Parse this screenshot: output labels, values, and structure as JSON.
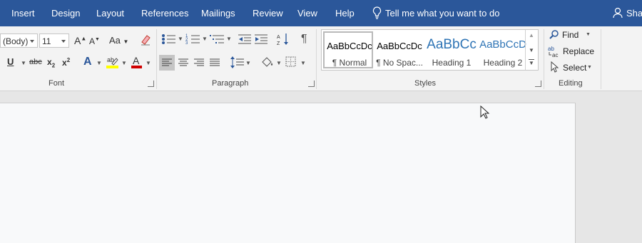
{
  "tabs": {
    "insert": "Insert",
    "design": "Design",
    "layout": "Layout",
    "references": "References",
    "mailings": "Mailings",
    "review": "Review",
    "view": "View",
    "help": "Help"
  },
  "tell_me": "Tell me what you want to do",
  "share": "Shar",
  "font": {
    "name": "(Body)",
    "size": "11",
    "group_label": "Font",
    "case_label": "Aa",
    "strike_label": "abc"
  },
  "paragraph": {
    "group_label": "Paragraph"
  },
  "styles": {
    "group_label": "Styles",
    "items": [
      {
        "sample": "AaBbCcDc",
        "name": "¶ Normal"
      },
      {
        "sample": "AaBbCcDc",
        "name": "¶ No Spac..."
      },
      {
        "sample": "AaBbCc",
        "name": "Heading 1"
      },
      {
        "sample": "AaBbCcD",
        "name": "Heading 2"
      }
    ]
  },
  "editing": {
    "group_label": "Editing",
    "find": "Find",
    "replace": "Replace",
    "select": "Select"
  },
  "colors": {
    "ribbon_tab_bg": "#2b579a",
    "highlight": "#ffff00",
    "font_color": "#d00000",
    "heading_blue": "#2e74b5"
  }
}
